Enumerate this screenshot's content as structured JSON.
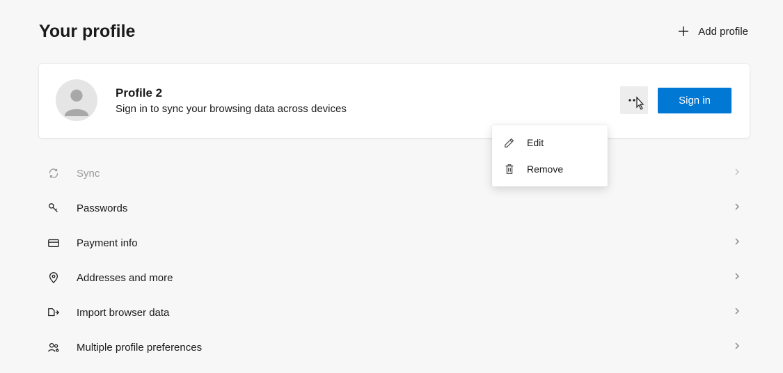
{
  "header": {
    "title": "Your profile",
    "add_profile_label": "Add profile"
  },
  "profile": {
    "name": "Profile 2",
    "subtext": "Sign in to sync your browsing data across devices",
    "signin_label": "Sign in"
  },
  "dropdown": {
    "edit_label": "Edit",
    "remove_label": "Remove"
  },
  "settings": {
    "items": [
      {
        "id": "sync",
        "label": "Sync",
        "icon": "sync-icon",
        "disabled": true
      },
      {
        "id": "passwords",
        "label": "Passwords",
        "icon": "key-icon",
        "disabled": false
      },
      {
        "id": "payment",
        "label": "Payment info",
        "icon": "card-icon",
        "disabled": false
      },
      {
        "id": "addresses",
        "label": "Addresses and more",
        "icon": "map-pin-icon",
        "disabled": false
      },
      {
        "id": "import",
        "label": "Import browser data",
        "icon": "import-icon",
        "disabled": false
      },
      {
        "id": "multiprofile",
        "label": "Multiple profile preferences",
        "icon": "people-icon",
        "disabled": false
      }
    ]
  }
}
